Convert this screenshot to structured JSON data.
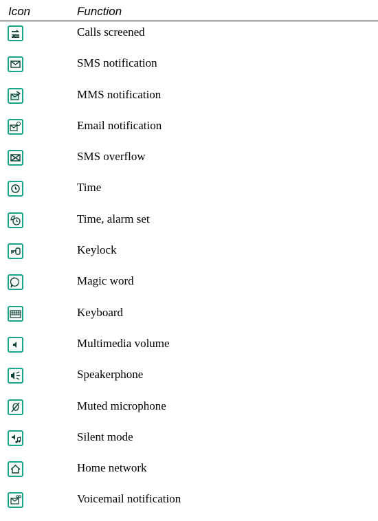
{
  "table": {
    "header": {
      "icon": "Icon",
      "function": "Function"
    },
    "rows": [
      {
        "icon": "calls-screened-icon",
        "label": "Calls screened"
      },
      {
        "icon": "sms-notification-icon",
        "label": "SMS notification"
      },
      {
        "icon": "mms-notification-icon",
        "label": "MMS notification"
      },
      {
        "icon": "email-notification-icon",
        "label": "Email notification"
      },
      {
        "icon": "sms-overflow-icon",
        "label": "SMS overflow"
      },
      {
        "icon": "time-icon",
        "label": "Time"
      },
      {
        "icon": "time-alarm-set-icon",
        "label": "Time, alarm set"
      },
      {
        "icon": "keylock-icon",
        "label": "Keylock"
      },
      {
        "icon": "magic-word-icon",
        "label": "Magic word"
      },
      {
        "icon": "keyboard-icon",
        "label": "Keyboard"
      },
      {
        "icon": "multimedia-volume-icon",
        "label": "Multimedia volume"
      },
      {
        "icon": "speakerphone-icon",
        "label": "Speakerphone"
      },
      {
        "icon": "muted-microphone-icon",
        "label": "Muted microphone"
      },
      {
        "icon": "silent-mode-icon",
        "label": "Silent mode"
      },
      {
        "icon": "home-network-icon",
        "label": "Home network"
      },
      {
        "icon": "voicemail-notification-icon",
        "label": "Voicemail notification"
      }
    ]
  },
  "colors": {
    "icon_frame": "#1aa58b",
    "icon_glyph": "#0b3d33",
    "text": "#000000"
  }
}
